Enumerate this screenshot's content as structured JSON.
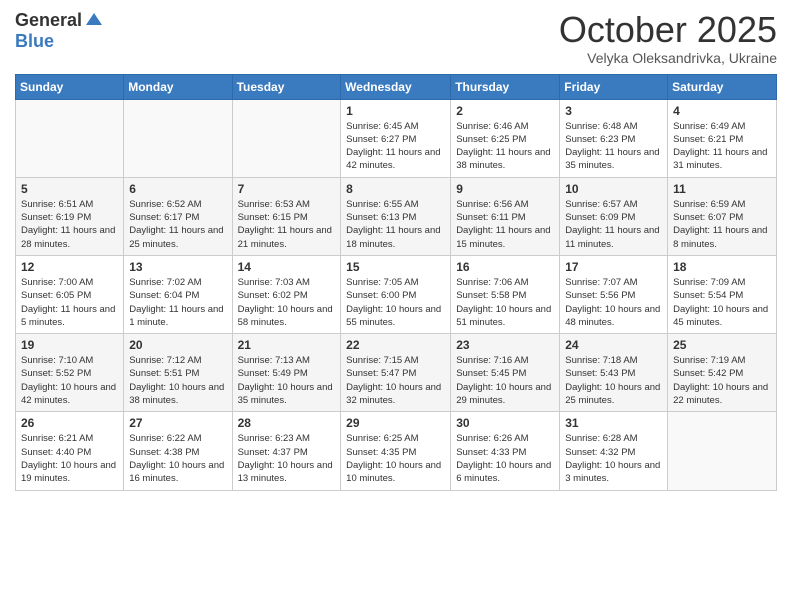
{
  "logo": {
    "general": "General",
    "blue": "Blue"
  },
  "title": "October 2025",
  "subtitle": "Velyka Oleksandrivka, Ukraine",
  "headers": [
    "Sunday",
    "Monday",
    "Tuesday",
    "Wednesday",
    "Thursday",
    "Friday",
    "Saturday"
  ],
  "weeks": [
    [
      {
        "day": "",
        "info": ""
      },
      {
        "day": "",
        "info": ""
      },
      {
        "day": "",
        "info": ""
      },
      {
        "day": "1",
        "info": "Sunrise: 6:45 AM\nSunset: 6:27 PM\nDaylight: 11 hours and 42 minutes."
      },
      {
        "day": "2",
        "info": "Sunrise: 6:46 AM\nSunset: 6:25 PM\nDaylight: 11 hours and 38 minutes."
      },
      {
        "day": "3",
        "info": "Sunrise: 6:48 AM\nSunset: 6:23 PM\nDaylight: 11 hours and 35 minutes."
      },
      {
        "day": "4",
        "info": "Sunrise: 6:49 AM\nSunset: 6:21 PM\nDaylight: 11 hours and 31 minutes."
      }
    ],
    [
      {
        "day": "5",
        "info": "Sunrise: 6:51 AM\nSunset: 6:19 PM\nDaylight: 11 hours and 28 minutes."
      },
      {
        "day": "6",
        "info": "Sunrise: 6:52 AM\nSunset: 6:17 PM\nDaylight: 11 hours and 25 minutes."
      },
      {
        "day": "7",
        "info": "Sunrise: 6:53 AM\nSunset: 6:15 PM\nDaylight: 11 hours and 21 minutes."
      },
      {
        "day": "8",
        "info": "Sunrise: 6:55 AM\nSunset: 6:13 PM\nDaylight: 11 hours and 18 minutes."
      },
      {
        "day": "9",
        "info": "Sunrise: 6:56 AM\nSunset: 6:11 PM\nDaylight: 11 hours and 15 minutes."
      },
      {
        "day": "10",
        "info": "Sunrise: 6:57 AM\nSunset: 6:09 PM\nDaylight: 11 hours and 11 minutes."
      },
      {
        "day": "11",
        "info": "Sunrise: 6:59 AM\nSunset: 6:07 PM\nDaylight: 11 hours and 8 minutes."
      }
    ],
    [
      {
        "day": "12",
        "info": "Sunrise: 7:00 AM\nSunset: 6:05 PM\nDaylight: 11 hours and 5 minutes."
      },
      {
        "day": "13",
        "info": "Sunrise: 7:02 AM\nSunset: 6:04 PM\nDaylight: 11 hours and 1 minute."
      },
      {
        "day": "14",
        "info": "Sunrise: 7:03 AM\nSunset: 6:02 PM\nDaylight: 10 hours and 58 minutes."
      },
      {
        "day": "15",
        "info": "Sunrise: 7:05 AM\nSunset: 6:00 PM\nDaylight: 10 hours and 55 minutes."
      },
      {
        "day": "16",
        "info": "Sunrise: 7:06 AM\nSunset: 5:58 PM\nDaylight: 10 hours and 51 minutes."
      },
      {
        "day": "17",
        "info": "Sunrise: 7:07 AM\nSunset: 5:56 PM\nDaylight: 10 hours and 48 minutes."
      },
      {
        "day": "18",
        "info": "Sunrise: 7:09 AM\nSunset: 5:54 PM\nDaylight: 10 hours and 45 minutes."
      }
    ],
    [
      {
        "day": "19",
        "info": "Sunrise: 7:10 AM\nSunset: 5:52 PM\nDaylight: 10 hours and 42 minutes."
      },
      {
        "day": "20",
        "info": "Sunrise: 7:12 AM\nSunset: 5:51 PM\nDaylight: 10 hours and 38 minutes."
      },
      {
        "day": "21",
        "info": "Sunrise: 7:13 AM\nSunset: 5:49 PM\nDaylight: 10 hours and 35 minutes."
      },
      {
        "day": "22",
        "info": "Sunrise: 7:15 AM\nSunset: 5:47 PM\nDaylight: 10 hours and 32 minutes."
      },
      {
        "day": "23",
        "info": "Sunrise: 7:16 AM\nSunset: 5:45 PM\nDaylight: 10 hours and 29 minutes."
      },
      {
        "day": "24",
        "info": "Sunrise: 7:18 AM\nSunset: 5:43 PM\nDaylight: 10 hours and 25 minutes."
      },
      {
        "day": "25",
        "info": "Sunrise: 7:19 AM\nSunset: 5:42 PM\nDaylight: 10 hours and 22 minutes."
      }
    ],
    [
      {
        "day": "26",
        "info": "Sunrise: 6:21 AM\nSunset: 4:40 PM\nDaylight: 10 hours and 19 minutes."
      },
      {
        "day": "27",
        "info": "Sunrise: 6:22 AM\nSunset: 4:38 PM\nDaylight: 10 hours and 16 minutes."
      },
      {
        "day": "28",
        "info": "Sunrise: 6:23 AM\nSunset: 4:37 PM\nDaylight: 10 hours and 13 minutes."
      },
      {
        "day": "29",
        "info": "Sunrise: 6:25 AM\nSunset: 4:35 PM\nDaylight: 10 hours and 10 minutes."
      },
      {
        "day": "30",
        "info": "Sunrise: 6:26 AM\nSunset: 4:33 PM\nDaylight: 10 hours and 6 minutes."
      },
      {
        "day": "31",
        "info": "Sunrise: 6:28 AM\nSunset: 4:32 PM\nDaylight: 10 hours and 3 minutes."
      },
      {
        "day": "",
        "info": ""
      }
    ]
  ]
}
